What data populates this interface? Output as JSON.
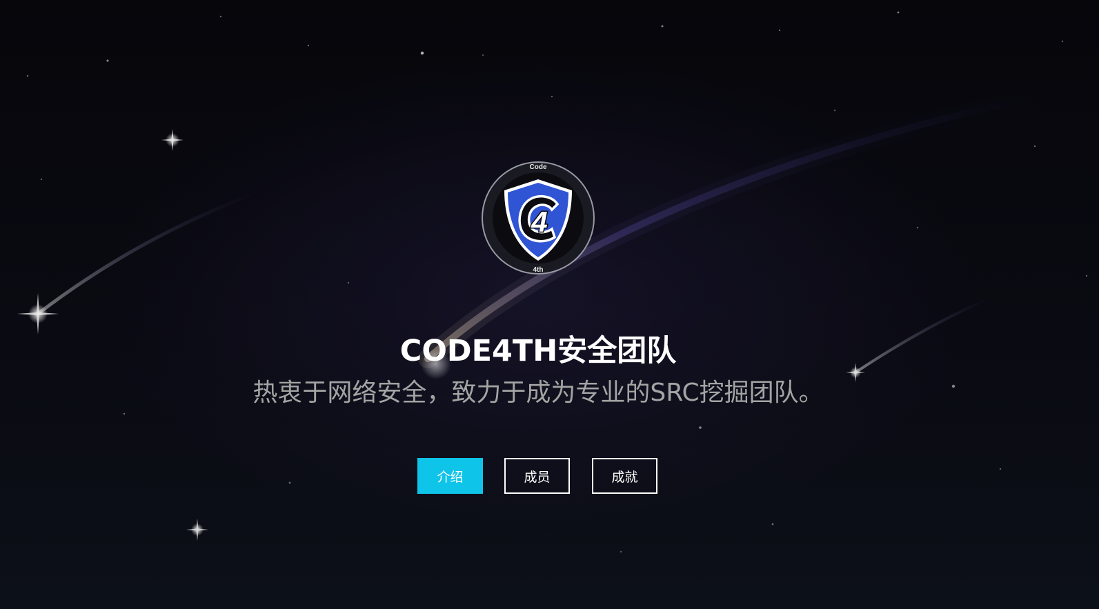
{
  "hero": {
    "title": "CODE4TH安全团队",
    "subtitle": "热衷于网络安全，致力于成为专业的SRC挖掘团队。"
  },
  "logo": {
    "top_text": "Code",
    "bottom_text": "4th",
    "emblem_text": "4"
  },
  "buttons": {
    "intro_label": "介绍",
    "members_label": "成员",
    "achievements_label": "成就"
  },
  "colors": {
    "accent": "#0fc4e9",
    "shield_blue": "#2f55d4",
    "background": "#05050a",
    "subtitle_gray": "#a4a4a4"
  }
}
